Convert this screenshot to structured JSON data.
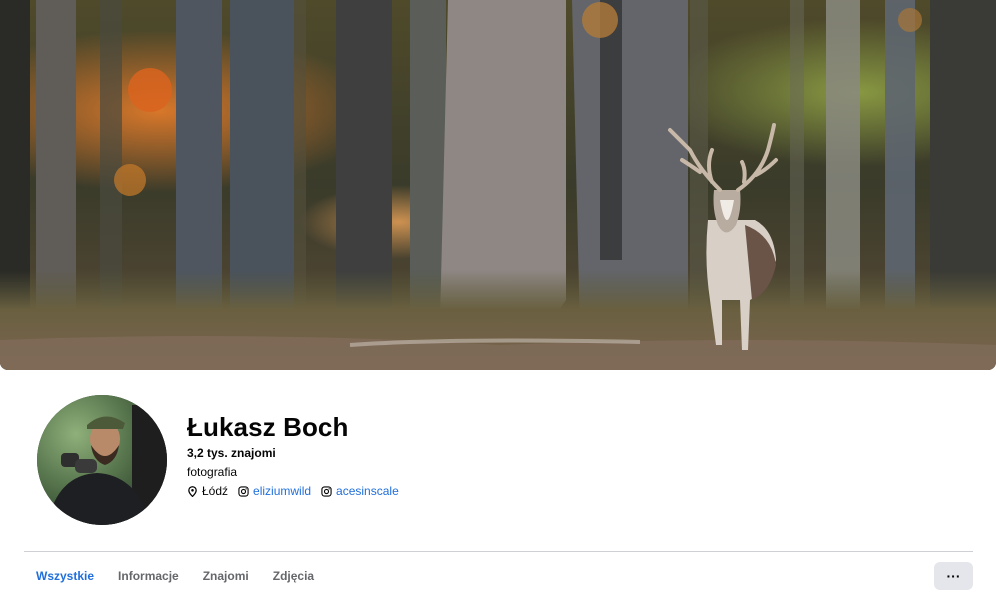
{
  "profile": {
    "name": "Łukasz Boch",
    "friends": "3,2 tys. znajomi",
    "bio": "fotografia",
    "location": "Łódź",
    "instagram_1": "eliziumwild",
    "instagram_2": "acesinscale"
  },
  "tabs": [
    {
      "label": "Wszystkie",
      "active": true
    },
    {
      "label": "Informacje",
      "active": false
    },
    {
      "label": "Znajomi",
      "active": false
    },
    {
      "label": "Zdjęcia",
      "active": false
    }
  ],
  "more_button": {
    "label": "···"
  },
  "colors": {
    "accent": "#216fdb",
    "tab_inactive": "#65676b",
    "button_bg": "#e4e6eb",
    "divider": "#ced0d4"
  },
  "icons": {
    "location": "map-pin-icon",
    "instagram": "instagram-icon",
    "more": "more-dots-icon"
  }
}
